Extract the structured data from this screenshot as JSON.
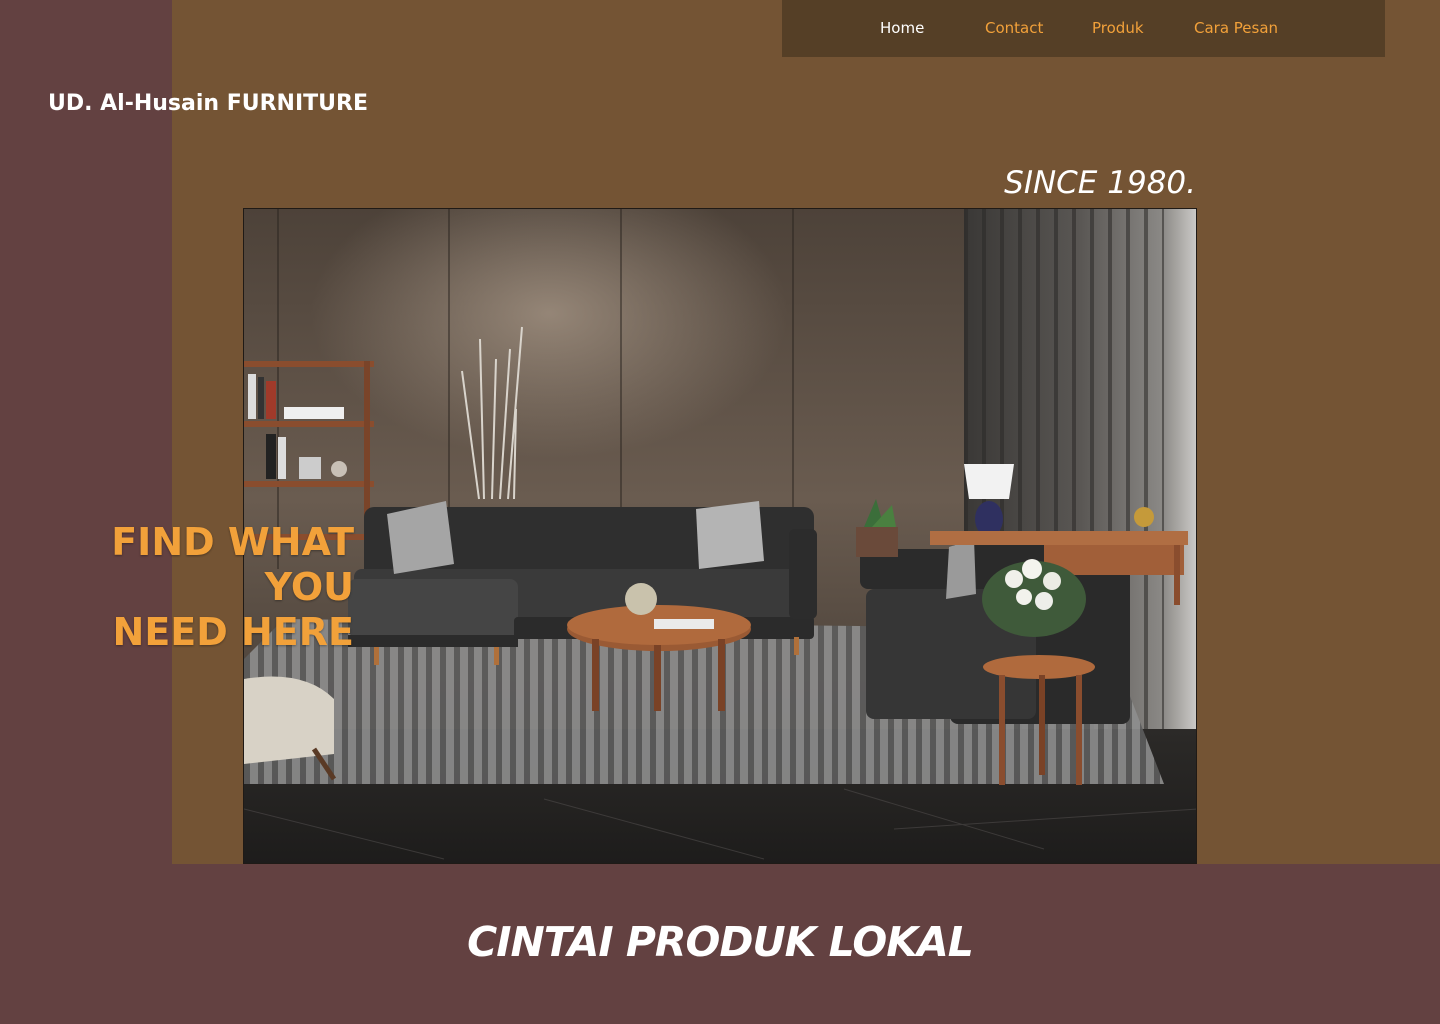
{
  "nav": {
    "items": [
      {
        "label": "Home",
        "active": true
      },
      {
        "label": "Contact",
        "active": false
      },
      {
        "label": "Produk",
        "active": false
      },
      {
        "label": "Cara Pesan",
        "active": false
      }
    ]
  },
  "brand": {
    "name": "UD. Al-Husain FURNITURE"
  },
  "hero": {
    "since": "SINCE 1980.",
    "tagline": [
      "FIND WHAT",
      "YOU",
      "NEED HERE"
    ],
    "image_subject": "living-room-sofa-scene"
  },
  "footer": {
    "slogan": "CINTAI PRODUK LOKAL"
  },
  "colors": {
    "background": "#634141",
    "panel": "#745434",
    "navbar": "#553f26",
    "accent": "#f2a13a",
    "text": "#ffffff"
  }
}
